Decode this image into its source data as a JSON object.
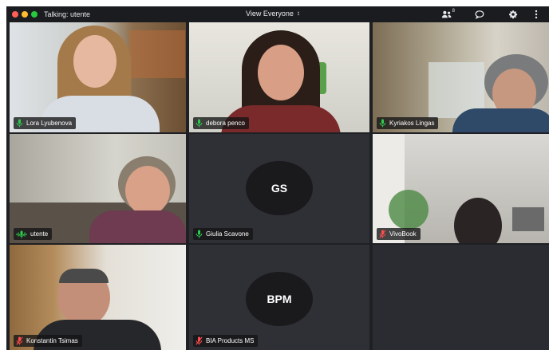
{
  "titlebar": {
    "talking": "Talking: utente",
    "view_label": "View Everyone",
    "participants_badge": "8"
  },
  "colors": {
    "background": "#1f2024",
    "mic_on": "#2ecc4f",
    "mic_muted": "#ff4d4f",
    "nametag_bg": "#141416"
  },
  "tiles": [
    {
      "name": "Lora Lyubenova",
      "mic": "on"
    },
    {
      "name": "debora penco",
      "mic": "on"
    },
    {
      "name": "Kyriakos Lingas",
      "mic": "on"
    },
    {
      "name": "utente",
      "mic": "speaking"
    },
    {
      "name": "Giulia Scavone",
      "mic": "on",
      "initials": "GS"
    },
    {
      "name": "VivoBook",
      "mic": "muted"
    },
    {
      "name": "Konstantin Tsimas",
      "mic": "muted"
    },
    {
      "name": "BIA Products MS",
      "mic": "muted",
      "initials": "BPM"
    }
  ],
  "icons": {
    "participants": "people-icon",
    "chat": "chat-bubble-icon",
    "settings": "gear-icon",
    "more": "more-vertical-icon"
  }
}
